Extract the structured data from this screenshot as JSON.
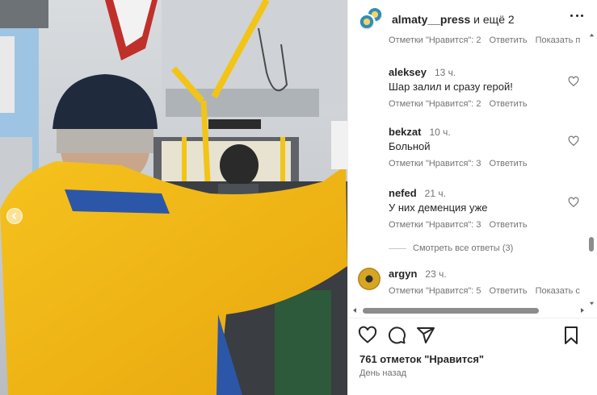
{
  "post": {
    "header_user": "almaty__press",
    "header_suffix": " и ещё 2",
    "likes_text": "761 отметок \"Нравится\"",
    "timestamp": "День назад"
  },
  "comments": [
    {
      "partial": true,
      "likes_text": "Отметки \"Нравится\": 2",
      "reply_label": "Ответить",
      "show_label": "Показать п"
    },
    {
      "user": "aleksey",
      "time": "13 ч.",
      "text": "Шар залил и сразу герой!",
      "likes_text": "Отметки \"Нравится\": 2",
      "reply_label": "Ответить"
    },
    {
      "user": "bekzat",
      "time": "10 ч.",
      "text": "Больной",
      "likes_text": "Отметки \"Нравится\": 3",
      "reply_label": "Ответить"
    },
    {
      "user": "nefed",
      "time": "21 ч.",
      "text": "У них деменция уже",
      "likes_text": "Отметки \"Нравится\": 3",
      "reply_label": "Ответить"
    },
    {
      "user": "argyn",
      "time": "23 ч.",
      "likes_text": "Отметки \"Нравится\": 5",
      "reply_label": "Ответить",
      "show_label": "Показать с"
    }
  ],
  "view_replies": "Смотреть все ответы (3)",
  "icons": [
    "more-icon",
    "heart-icon",
    "comment-icon",
    "share-icon",
    "bookmark-icon",
    "chevron-left-icon"
  ]
}
